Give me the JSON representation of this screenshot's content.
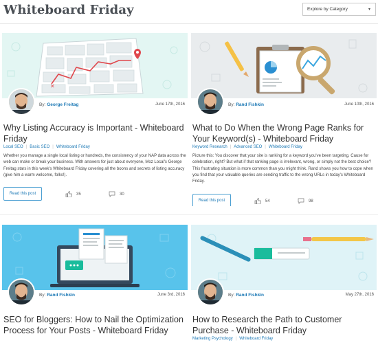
{
  "page": {
    "title": "Whiteboard Friday"
  },
  "explore": {
    "label": "Explore by Category"
  },
  "cards": [
    {
      "author_prefix": "By:",
      "author": "George Freitag",
      "date": "June 17th, 2016",
      "title": "Why Listing Accuracy is Important - Whiteboard Friday",
      "tags": [
        "Local SEO",
        "Basic SEO",
        "Whiteboard Friday"
      ],
      "description": "Whether you manage a single local listing or hundreds, the consistency of your NAP data across the web can make or break your business. With answers for just about everyone, Moz Local's George Freitag stars in this week's Whiteboard Friday covering all the boons and secrets of listing accuracy (give him a warm welcome, folks!).",
      "button": "Read this post",
      "likes": "35",
      "comments": "30",
      "hero_bg": "#e3f6f3"
    },
    {
      "author_prefix": "By:",
      "author": "Rand Fishkin",
      "date": "June 10th, 2016",
      "title": "What to Do When the Wrong Page Ranks for Your Keyword(s) - Whiteboard Friday",
      "tags": [
        "Keyword Research",
        "Advanced SEO",
        "Whiteboard Friday"
      ],
      "description": "Picture this: You discover that your site is ranking for a keyword you've been targeting. Cause for celebration, right? But what if that ranking page is irrelevant, wrong, or simply not the best choice? This frustrating situation is more common than you might think. Rand shows you how to cope when you find that your valuable queries are sending traffic to the wrong URLs in today's Whiteboard Friday.",
      "button": "Read this post",
      "likes": "54",
      "comments": "98",
      "hero_bg": "#e9ecee"
    },
    {
      "author_prefix": "By:",
      "author": "Rand Fishkin",
      "date": "June 3rd, 2016",
      "title": "SEO for Bloggers: How to Nail the Optimization Process for Your Posts - Whiteboard Friday",
      "hero_bg": "#58c3eb"
    },
    {
      "author_prefix": "By:",
      "author": "Rand Fishkin",
      "date": "May 27th, 2016",
      "title": "How to Research the Path to Customer Purchase - Whiteboard Friday",
      "tags": [
        "Marketing Psychology",
        "Whiteboard Friday"
      ],
      "hero_bg": "#dff3f7"
    }
  ],
  "colors": {
    "link": "#1b78b5",
    "border": "#4b9fd2"
  }
}
